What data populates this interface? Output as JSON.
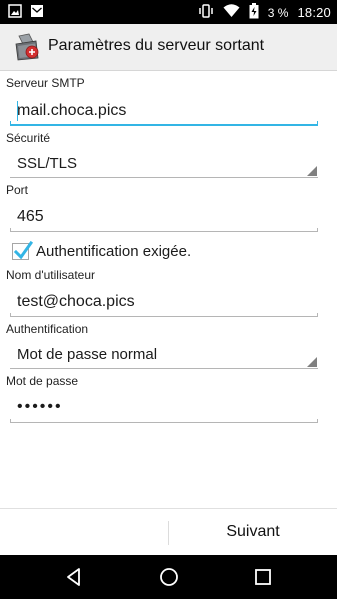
{
  "status_bar": {
    "battery": "3 %",
    "time": "18:20",
    "icons": [
      "screenshot-icon",
      "mail-icon",
      "vibrate-icon",
      "wifi-icon",
      "battery-charging-icon"
    ]
  },
  "action_bar": {
    "title": "Paramètres du serveur sortant",
    "icon": "app-icon"
  },
  "form": {
    "smtp_label": "Serveur SMTP",
    "smtp_value": "mail.choca.pics",
    "security_label": "Sécurité",
    "security_value": "SSL/TLS",
    "port_label": "Port",
    "port_value": "465",
    "auth_required_label": "Authentification exigée.",
    "auth_required_checked": true,
    "username_label": "Nom d'utilisateur",
    "username_value": "test@choca.pics",
    "auth_label": "Authentification",
    "auth_value": "Mot de passe normal",
    "password_label": "Mot de passe",
    "password_value": "••••••"
  },
  "bottom_bar": {
    "next_label": "Suivant"
  },
  "colors": {
    "accent": "#33b5e5",
    "status_bar": "#000000",
    "action_bar": "#efefef"
  }
}
